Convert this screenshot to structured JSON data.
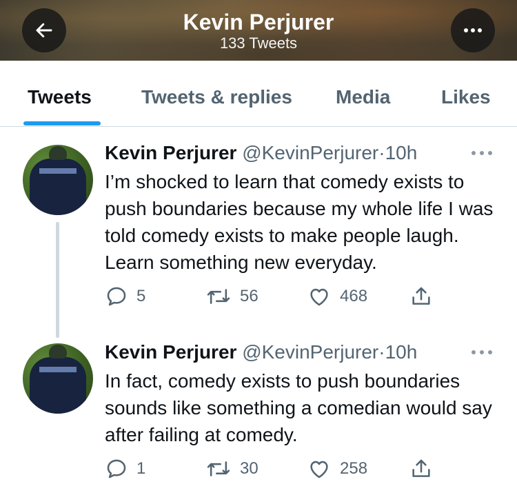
{
  "header": {
    "title": "Kevin Perjurer",
    "subtitle": "133 Tweets"
  },
  "tabs": [
    {
      "label": "Tweets",
      "active": true
    },
    {
      "label": "Tweets & replies",
      "active": false
    },
    {
      "label": "Media",
      "active": false
    },
    {
      "label": "Likes",
      "active": false
    }
  ],
  "colors": {
    "accent": "#1d9bf0",
    "text": "#0f1419",
    "muted": "#536471"
  },
  "tweets": [
    {
      "name": "Kevin Perjurer",
      "handle": "@KevinPerjurer",
      "separator": "·",
      "time": "10h",
      "text": "I’m shocked to learn that comedy exists to push boundaries because my whole life I was told comedy exists to make people laugh. Learn something new everyday.",
      "replies": "5",
      "retweets": "56",
      "likes": "468"
    },
    {
      "name": "Kevin Perjurer",
      "handle": "@KevinPerjurer",
      "separator": "·",
      "time": "10h",
      "text": "In fact, comedy exists to push boundaries sounds like something a comedian would say after failing at comedy.",
      "replies": "1",
      "retweets": "30",
      "likes": "258"
    }
  ]
}
